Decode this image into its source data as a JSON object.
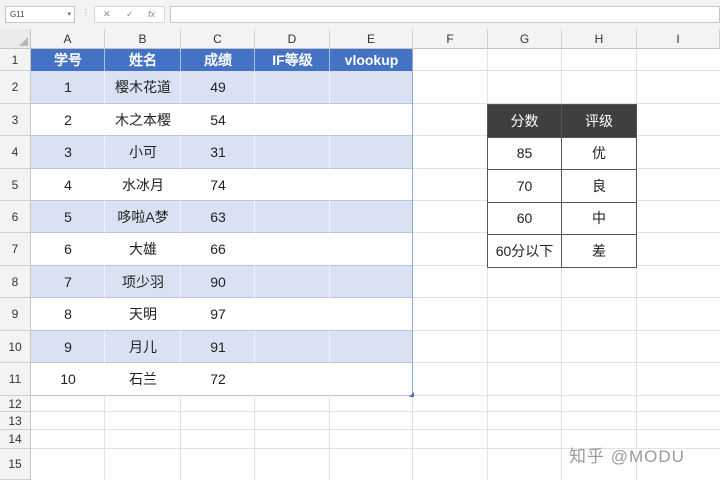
{
  "formula_bar": {
    "name_box": "G11",
    "cancel_glyph": "✕",
    "enter_glyph": "✓",
    "fx_glyph": "fx",
    "formula": ""
  },
  "columns": [
    "A",
    "B",
    "C",
    "D",
    "E",
    "F",
    "G",
    "H",
    "I"
  ],
  "rows": [
    "1",
    "2",
    "3",
    "4",
    "5",
    "6",
    "7",
    "8",
    "9",
    "10",
    "11",
    "12",
    "13",
    "14",
    "15"
  ],
  "table": {
    "headers": [
      "学号",
      "姓名",
      "成绩",
      "IF等级",
      "vlookup"
    ],
    "rows": [
      [
        "1",
        "樱木花道",
        "49",
        "",
        ""
      ],
      [
        "2",
        "木之本樱",
        "54",
        "",
        ""
      ],
      [
        "3",
        "小可",
        "31",
        "",
        ""
      ],
      [
        "4",
        "水冰月",
        "74",
        "",
        ""
      ],
      [
        "5",
        "哆啦A梦",
        "63",
        "",
        ""
      ],
      [
        "6",
        "大雄",
        "66",
        "",
        ""
      ],
      [
        "7",
        "项少羽",
        "90",
        "",
        ""
      ],
      [
        "8",
        "天明",
        "97",
        "",
        ""
      ],
      [
        "9",
        "月儿",
        "91",
        "",
        ""
      ],
      [
        "10",
        "石兰",
        "72",
        "",
        ""
      ]
    ]
  },
  "lookup_table": {
    "headers": [
      "分数",
      "评级"
    ],
    "rows": [
      [
        "85",
        "优"
      ],
      [
        "70",
        "良"
      ],
      [
        "60",
        "中"
      ],
      [
        "60分以下",
        "差"
      ]
    ]
  },
  "watermark": "知乎 @MODU",
  "colors": {
    "header_fill": "#4472c4",
    "band_fill": "#d9e1f2",
    "lookup_header_fill": "#3f3f3f"
  }
}
